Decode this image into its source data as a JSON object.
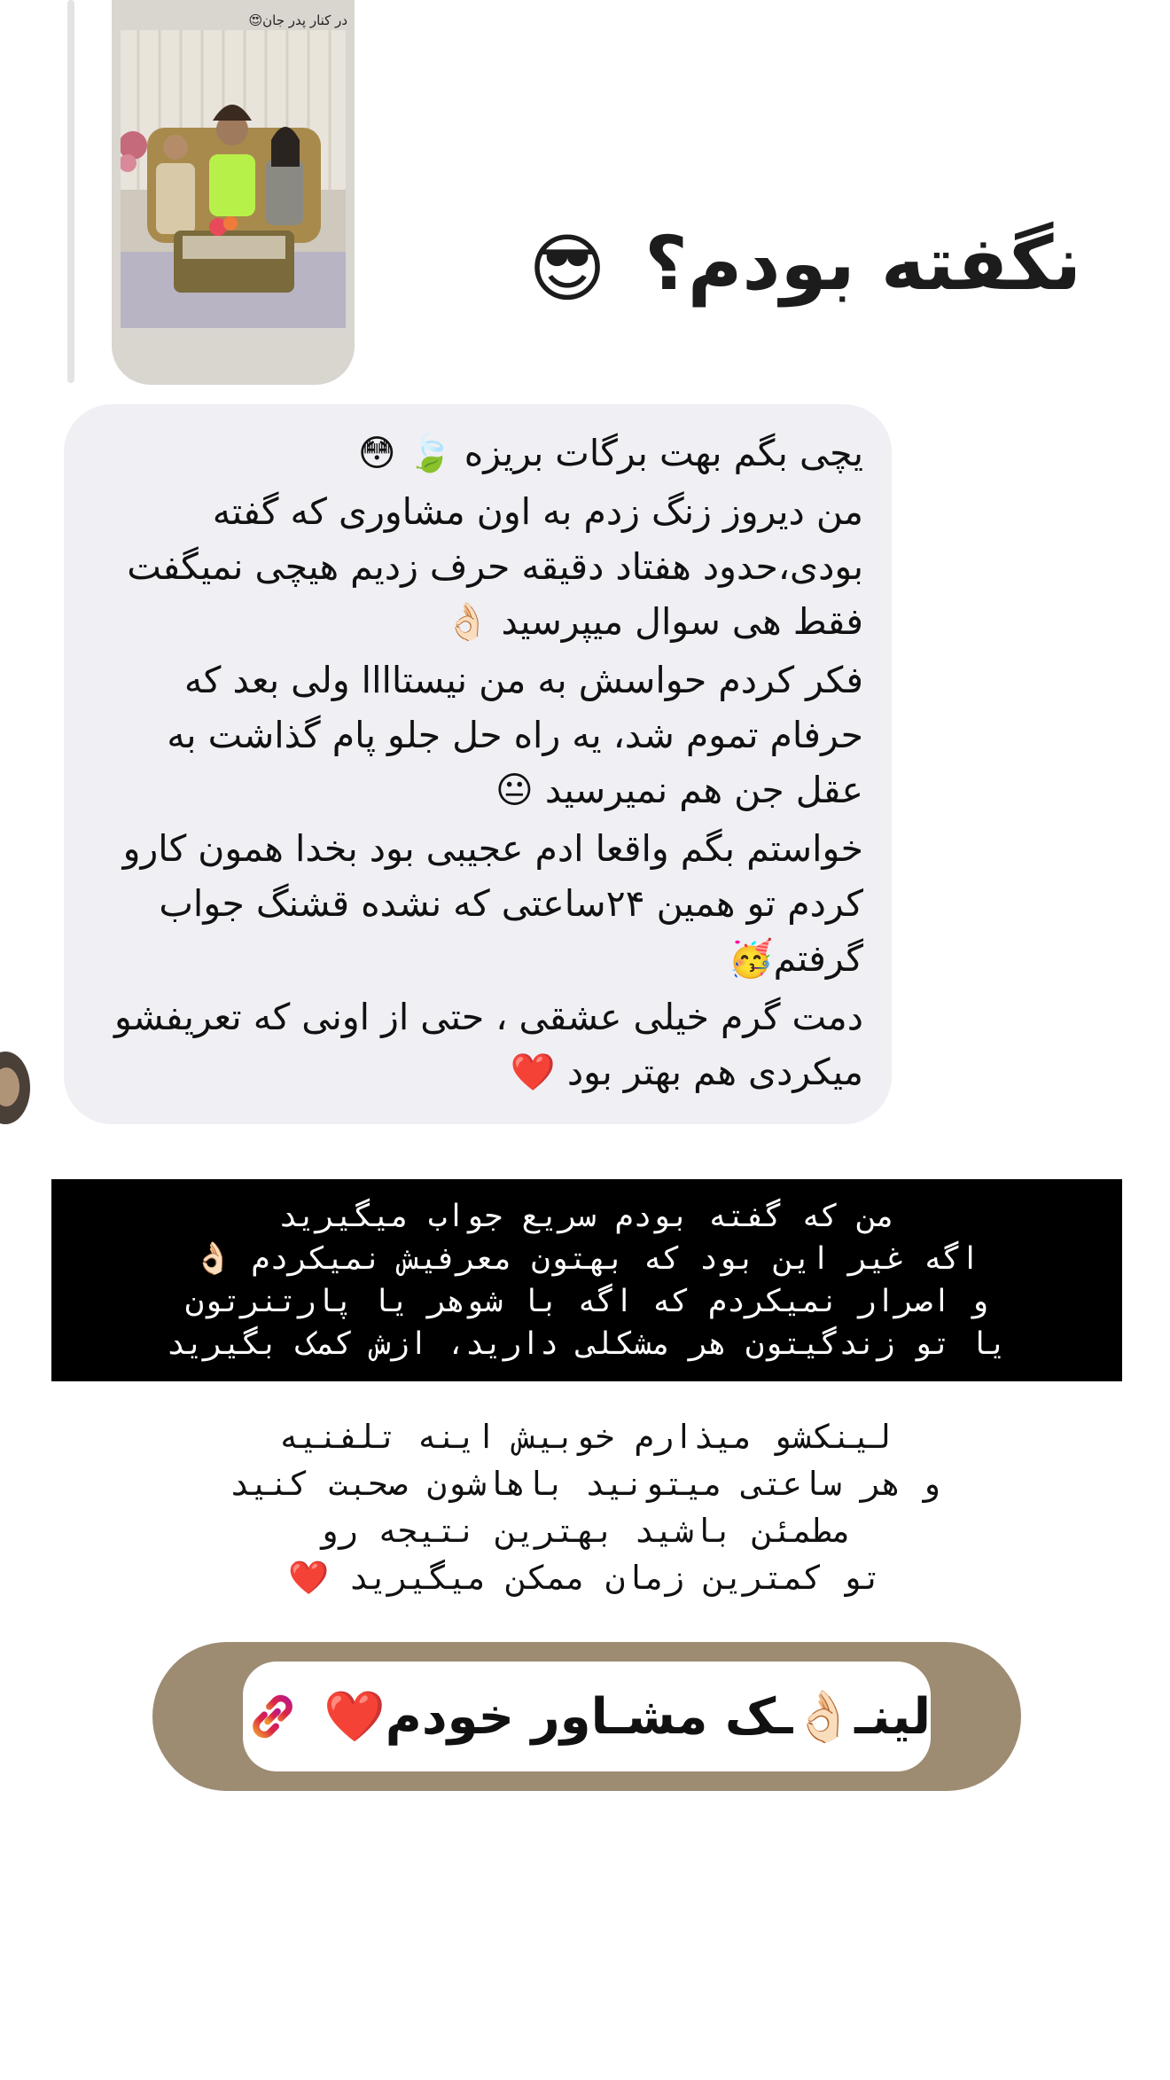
{
  "story": {
    "caption": "در کنار پدر جان😍"
  },
  "headline": {
    "text": "نگفته بودم؟",
    "emoji": "😎"
  },
  "message": {
    "paragraphs": [
      {
        "text": "یچی بگم بهت برگات بریزه 🍃 😳"
      },
      {
        "text": "من دیروز زنگ زدم به اون مشاوری که گفته بودی،حدود هفتاد دقیقه حرف زدیم هیچی نمیگفت فقط هی سوال میپرسید 👌🏻"
      },
      {
        "text": "فکر کردم حواسش به من نیستاااا ولی بعد که حرفام تموم شد، یه راه حل جلو پام گذاشت به عقل جن هم نمیرسید 😐"
      },
      {
        "text": "خواستم بگم واقعا ادم عجیبی بود بخدا همون کارو کردم تو همین ۲۴ساعتی که نشده قشنگ جواب گرفتم🥳"
      },
      {
        "text": "دمت گرم خیلی عشقی ، حتی از اونی که تعریفشو میکردی هم بهتر بود ❤️"
      }
    ]
  },
  "notice": {
    "lines": [
      "من که گفته بودم سریع جواب میگیرید",
      "اگه غیر این بود که بهتون معرفیش نمیکردم 👌🏻",
      "و اصرار نمیکردم که اگه با شوهر یا پارتنرتون",
      "یا تو زندگیتون هر مشکلی دارید، ازش کمک بگیرید"
    ]
  },
  "promo": {
    "lines": [
      "لینکشو میذارم خوبیش اینه تلفنیه",
      "و هر ساعتی میتونید باهاشون صحبت کنید",
      "مطمئن باشید بهترین نتیجه رو",
      "تو کمترین زمان ممکن میگیرید ❤️"
    ]
  },
  "link_button": {
    "label": "لینـ👌🏻ـک مشـاور خودم❤️",
    "icon": "link-icon",
    "colors": {
      "pill": "#9d8c72",
      "icon_gradient_start": "#f09433",
      "icon_gradient_end": "#bc1888"
    }
  }
}
